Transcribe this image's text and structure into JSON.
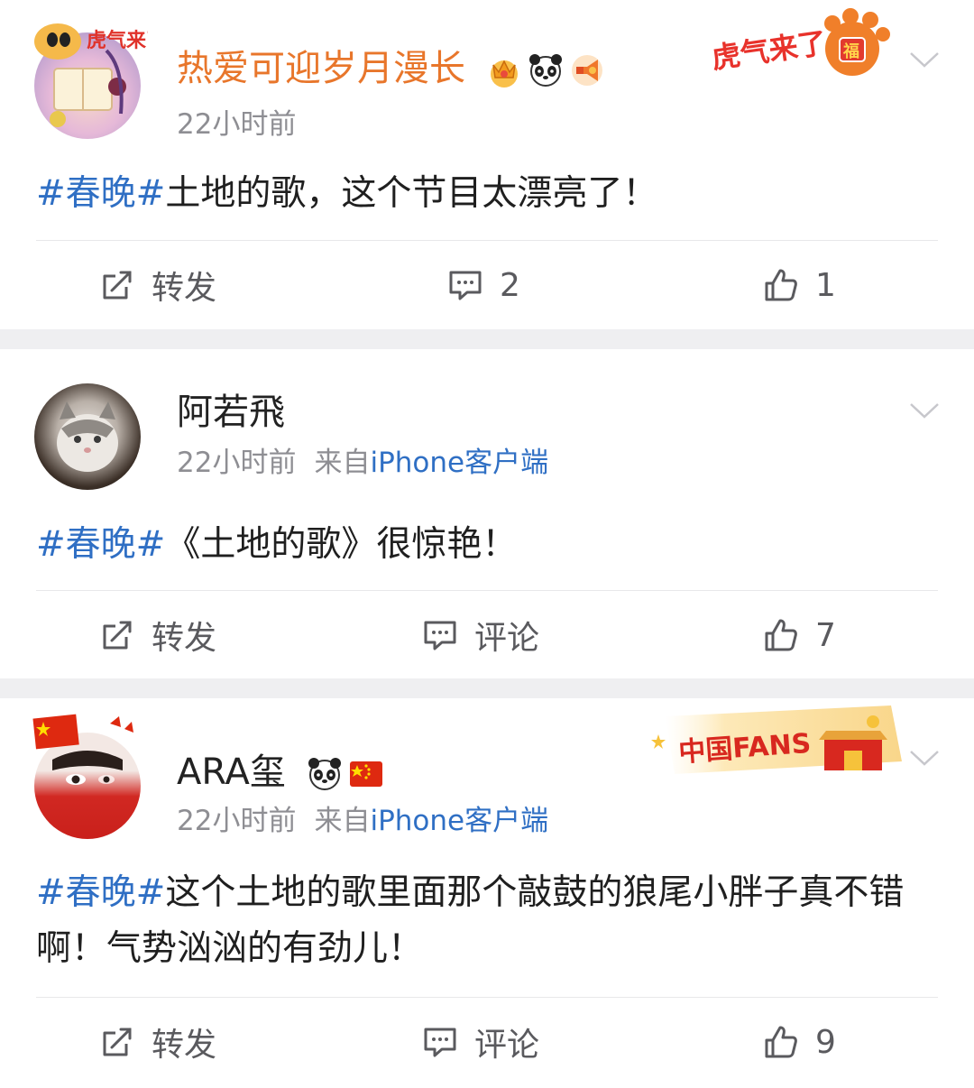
{
  "posts": [
    {
      "username": "热爱可迎岁月漫长",
      "username_color": "#e8762b",
      "avatar_deco_text": "虎气来了",
      "card_deco_text": "虎气来了",
      "card_deco_badge": "福",
      "time": "22小时前",
      "source_prefix": "",
      "source_device": "",
      "hashtag": "#春晚#",
      "text": "土地的歌，这个节目太漂亮了！",
      "repost_label": "转发",
      "comment_label": "2",
      "like_label": "1"
    },
    {
      "username": "阿若飛",
      "time": "22小时前",
      "source_prefix": "来自",
      "source_device": "iPhone客户端",
      "hashtag": "#春晚#",
      "text": "《土地的歌》很惊艳！",
      "repost_label": "转发",
      "comment_label": "评论",
      "like_label": "7"
    },
    {
      "username": "ARA玺",
      "card_deco_text": "中国FANS",
      "time": "22小时前",
      "source_prefix": "来自",
      "source_device": "iPhone客户端",
      "hashtag": "#春晚#",
      "text": "这个土地的歌里面那个敲鼓的狼尾小胖子真不错啊！气势汹汹的有劲儿！",
      "repost_label": "转发",
      "comment_label": "评论",
      "like_label": "9"
    }
  ],
  "colors": {
    "link": "#2f6fc4",
    "meta": "#8e8e93",
    "separator": "#efeff1",
    "action": "#5a5a5e"
  },
  "icons": [
    "repost-icon",
    "comment-icon",
    "like-icon",
    "chevron-down-icon",
    "crown-icon",
    "panda-icon",
    "megaphone-icon",
    "china-flag-icon"
  ]
}
